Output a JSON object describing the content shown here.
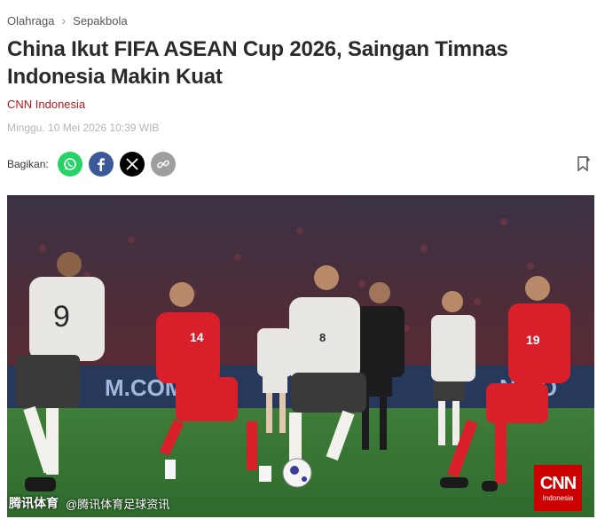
{
  "breadcrumb": {
    "items": [
      "Olahraga",
      "Sepakbola"
    ]
  },
  "article": {
    "title": "China Ikut FIFA ASEAN Cup 2026, Saingan Timnas Indonesia Makin Kuat",
    "source": "CNN Indonesia",
    "date": "Minggu, 10 Mei 2026 10:39 WIB"
  },
  "share": {
    "label": "Bagikan:",
    "buttons": [
      {
        "name": "whatsapp",
        "icon": "whatsapp-icon",
        "color": "#25d366"
      },
      {
        "name": "facebook",
        "icon": "facebook-icon",
        "color": "#3b5998"
      },
      {
        "name": "x",
        "icon": "x-icon",
        "color": "#000000"
      },
      {
        "name": "copy-link",
        "icon": "link-icon",
        "color": "#9e9e9e"
      }
    ],
    "bookmark_icon": "bookmark-icon"
  },
  "photo": {
    "player_numbers": [
      "9",
      "14",
      "8",
      "19"
    ],
    "ad_board_text": [
      "M.COM",
      "N.CO"
    ],
    "watermark_brand": "腾讯体育",
    "watermark_handle": "@腾讯体育足球资讯",
    "badge_logo": "CNN",
    "badge_sub": "Indonesia"
  }
}
